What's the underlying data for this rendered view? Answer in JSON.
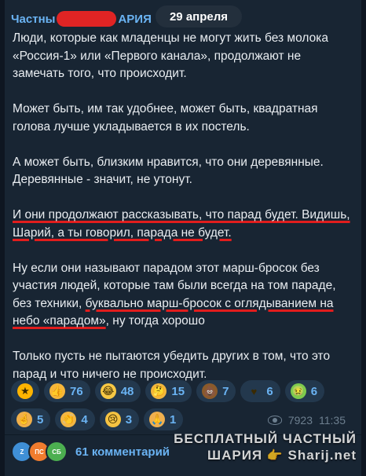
{
  "post": {
    "channel_prefix": "Частны",
    "channel_suffix": "АРИЯ",
    "date": "29 апреля",
    "paragraphs": [
      {
        "segments": [
          {
            "text": "Люди, которые как младенцы не могут жить без молока «Россия-1» или «Первого канала», продолжают не замечать того, что происходит."
          }
        ]
      },
      {
        "segments": [
          {
            "text": "Может быть, им так удобнее, может быть, квадратная голова лучше укладывается в их постель."
          }
        ]
      },
      {
        "segments": [
          {
            "text": "А может быть, близким нравится, что они деревянные. Деревянные - значит, не утонут."
          }
        ]
      },
      {
        "segments": [
          {
            "text": "И они продолжают рассказывать, что парад будет. Видишь, Шарий, а ты говорил, парада не будет.",
            "highlighted": true
          }
        ]
      },
      {
        "segments": [
          {
            "text": "Ну если они называют парадом этот марш-бросок без участия людей, которые там были всегда на том параде, без техники, "
          },
          {
            "text": "буквально марш-бросок с оглядыванием на небо «парадом»",
            "highlighted": true
          },
          {
            "text": ", ну тогда хорошо"
          }
        ]
      },
      {
        "segments": [
          {
            "text": "Только пусть не пытаются убедить других в том, что это парад и что ничего не происходит."
          }
        ]
      }
    ]
  },
  "reactions": {
    "row1": [
      {
        "icon": "star-icon",
        "glyph": "★",
        "cls": "e-star",
        "count": ""
      },
      {
        "icon": "thumbs-up-icon",
        "glyph": "👍",
        "cls": "e-thumb",
        "count": "76"
      },
      {
        "icon": "rofl-face-icon",
        "glyph": "😂",
        "cls": "e-laugh",
        "count": "48"
      },
      {
        "icon": "thinking-face-icon",
        "glyph": "🤔",
        "cls": "e-think",
        "count": "15"
      },
      {
        "icon": "poop-icon",
        "glyph": "💩",
        "cls": "e-poop",
        "count": "7"
      },
      {
        "icon": "heart-icon",
        "glyph": "♥",
        "cls": "e-heart",
        "count": "6"
      },
      {
        "icon": "nauseated-face-icon",
        "glyph": "🤢",
        "cls": "e-sick",
        "count": "6"
      }
    ],
    "row2": [
      {
        "icon": "crossed-fingers-icon",
        "glyph": "🤞",
        "cls": "e-fingers",
        "count": "5"
      },
      {
        "icon": "clapping-hands-icon",
        "glyph": "👏",
        "cls": "e-clap",
        "count": "4"
      },
      {
        "icon": "crying-face-icon",
        "glyph": "😢",
        "cls": "e-cry",
        "count": "3"
      },
      {
        "icon": "praying-hands-icon",
        "glyph": "🙏",
        "cls": "e-pray",
        "count": "1"
      }
    ]
  },
  "meta": {
    "views": "7923",
    "time": "11:35"
  },
  "comments": {
    "avatars": [
      "Z",
      "ПС",
      "СБ"
    ],
    "label": "61 комментарий"
  },
  "watermark": {
    "line1": "БЕСПЛАТНЫЙ ЧАСТНЫЙ",
    "line2": "ШАРИЯ",
    "hand": "👉",
    "site": "Sharij.net"
  },
  "colors": {
    "background": "#0e1621",
    "bubble": "#182533",
    "accent": "#6ab3f3",
    "text": "#e9edf1",
    "underline": "#e11d1d",
    "redaction": "#e02424",
    "muted": "#6d7f8f"
  }
}
